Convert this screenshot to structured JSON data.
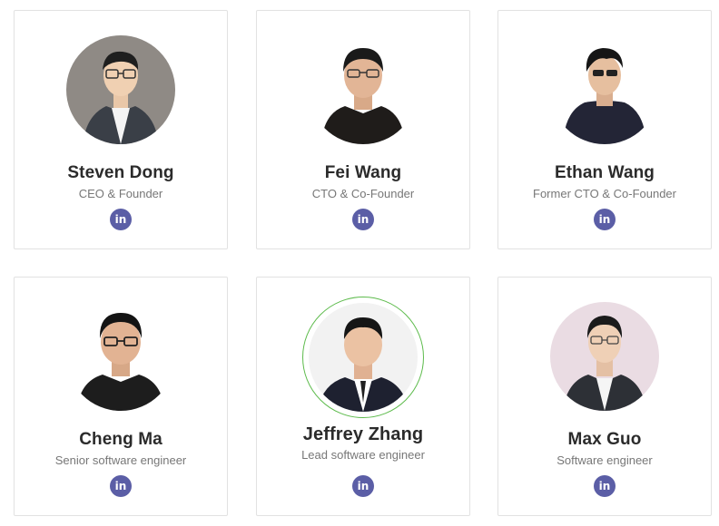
{
  "team": [
    {
      "name": "Steven Dong",
      "role": "CEO & Founder",
      "linkedin_label": "in",
      "featured": false,
      "photo_bg": "#8f8a85"
    },
    {
      "name": "Fei Wang",
      "role": "CTO & Co-Founder",
      "linkedin_label": "in",
      "featured": false,
      "photo_bg": "#ffffff"
    },
    {
      "name": "Ethan Wang",
      "role": "Former CTO & Co-Founder",
      "linkedin_label": "in",
      "featured": false,
      "photo_bg": "#ffffff"
    },
    {
      "name": "Cheng Ma",
      "role": "Senior software engineer",
      "linkedin_label": "in",
      "featured": false,
      "photo_bg": "#ffffff"
    },
    {
      "name": "Jeffrey Zhang",
      "role": "Lead software engineer",
      "linkedin_label": "in",
      "featured": true,
      "photo_bg": "#f2f2f2"
    },
    {
      "name": "Max Guo",
      "role": "Software engineer",
      "linkedin_label": "in",
      "featured": false,
      "photo_bg": "#eadce3"
    }
  ],
  "colors": {
    "linkedin_badge": "#5b5ea6",
    "featured_ring": "#5dbb4c",
    "name_text": "#2b2b2b",
    "role_text": "#777777"
  }
}
